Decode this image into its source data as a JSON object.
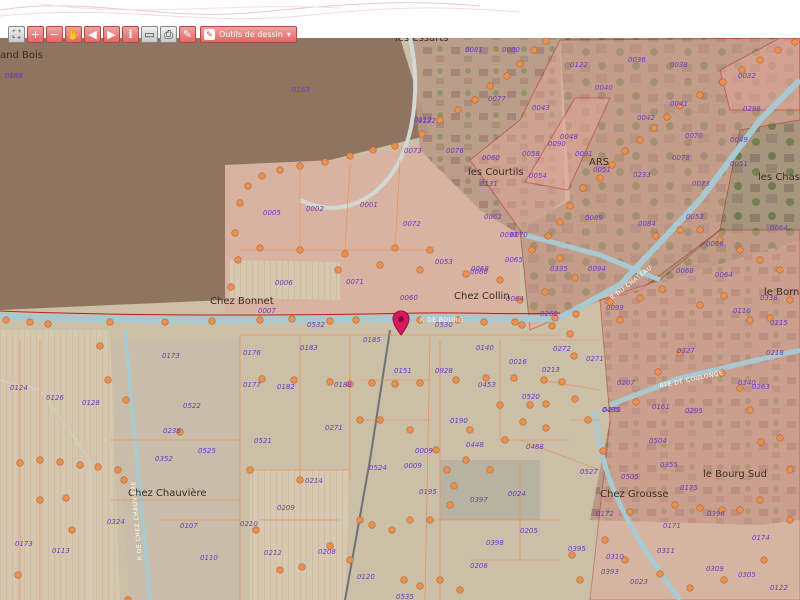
{
  "toolbar": {
    "buttons": [
      {
        "name": "zoom-extent-button",
        "icon": "fullscreen-icon",
        "glyph": "⛶"
      },
      {
        "name": "zoom-in-button",
        "icon": "plus-icon",
        "glyph": "+"
      },
      {
        "name": "zoom-out-button",
        "icon": "minus-icon",
        "glyph": "−"
      },
      {
        "name": "pan-button",
        "icon": "hand-icon",
        "glyph": "✋"
      },
      {
        "name": "previous-view-button",
        "icon": "arrow-left-icon",
        "glyph": "◀"
      },
      {
        "name": "next-view-button",
        "icon": "arrow-right-icon",
        "glyph": "▶"
      },
      {
        "name": "info-button",
        "icon": "info-icon",
        "glyph": "ℹ"
      },
      {
        "name": "measure-button",
        "icon": "ruler-icon",
        "glyph": "▭"
      },
      {
        "name": "print-button",
        "icon": "printer-icon",
        "glyph": "⎙"
      },
      {
        "name": "clear-button",
        "icon": "eraser-icon",
        "glyph": "✎"
      }
    ],
    "drawing_tools_label": "Outils de dessin",
    "drawing_tools_caret": "▾",
    "accent": "#e26666"
  },
  "map": {
    "places": [
      {
        "id": "place-grand-bois",
        "label": "and Bois"
      },
      {
        "id": "place-les-essarts",
        "label": "les Essarts"
      },
      {
        "id": "place-les-courtils",
        "label": "les Courtils"
      },
      {
        "id": "place-chez-bonnet",
        "label": "Chez Bonnet"
      },
      {
        "id": "place-chez-collin",
        "label": "Chez Collin"
      },
      {
        "id": "place-les-chassa",
        "label": "les Chassa"
      },
      {
        "id": "place-le-borne",
        "label": "le Borne"
      },
      {
        "id": "place-chez-chauviere",
        "label": "Chez Chauvière"
      },
      {
        "id": "place-le-bourg-sud",
        "label": "le Bourg Sud"
      },
      {
        "id": "place-chez-grousse",
        "label": "Chez Grousse"
      },
      {
        "id": "place-ars",
        "label": "ARS"
      }
    ],
    "roads": [
      {
        "id": "road-chateau",
        "label": "R DU CHATEAU"
      },
      {
        "id": "road-coulonge",
        "label": "RTE DE COULONGE"
      },
      {
        "id": "road-chauviere",
        "label": "R DE CHEZ CHAUVIERE"
      },
      {
        "id": "road-main",
        "label": "R DE BOURG"
      }
    ],
    "parcels": [
      "0184",
      "0163",
      "0081",
      "0080",
      "0122",
      "0036",
      "0038",
      "0032",
      "0077",
      "0043",
      "0040",
      "0042",
      "0041",
      "0296",
      "0122",
      "0112",
      "0048",
      "0090",
      "0070",
      "0049",
      "0073",
      "0076",
      "0060",
      "0058",
      "0091",
      "0051",
      "0233",
      "0078",
      "0051",
      "0131",
      "0054",
      "0089",
      "0073",
      "0064",
      "0005",
      "0002",
      "0001",
      "0072",
      "0062",
      "0070",
      "0052",
      "0009",
      "0093",
      "0084",
      "0066",
      "0053",
      "0068",
      "0066",
      "0335",
      "0094",
      "0065",
      "0068",
      "0064",
      "0006",
      "0071",
      "0060",
      "0064",
      "0099",
      "0110",
      "0115",
      "0007",
      "0532",
      "0530",
      "0260",
      "0338",
      "0173",
      "0176",
      "0183",
      "0185",
      "0140",
      "0016",
      "0272",
      "0271",
      "0327",
      "0238",
      "0218",
      "0124",
      "0126",
      "0128",
      "0522",
      "0177",
      "0182",
      "0188",
      "0151",
      "0928",
      "0453",
      "0213",
      "0207",
      "0161",
      "0295",
      "0340",
      "0263",
      "0271",
      "0190",
      "0520",
      "0485",
      "0238",
      "0521",
      "0448",
      "0488",
      "0504",
      "0355",
      "0352",
      "0525",
      "0524",
      "0009",
      "0527",
      "0505",
      "0175",
      "0214",
      "0195",
      "0024",
      "0397",
      "0396",
      "0171",
      "0172",
      "0174",
      "0324",
      "0107",
      "0210",
      "0209",
      "0205",
      "0398",
      "0395",
      "0310",
      "0311",
      "0173",
      "0113",
      "0110",
      "0212",
      "0208",
      "0206",
      "0393",
      "0309",
      "0305",
      "0120",
      "0535",
      "0023",
      "0122",
      "0033"
    ],
    "marker_icon": "map-pin-icon",
    "colors": {
      "forest": "#8f7561",
      "parcel_fill": "#e8b8a8",
      "field": "#d9c8ae",
      "orange_line": "#e89050",
      "boundary": "#b8201a",
      "road": "#a9c9d1",
      "marker": "#d81b60",
      "parcel_label": "#6a3cc4"
    }
  }
}
